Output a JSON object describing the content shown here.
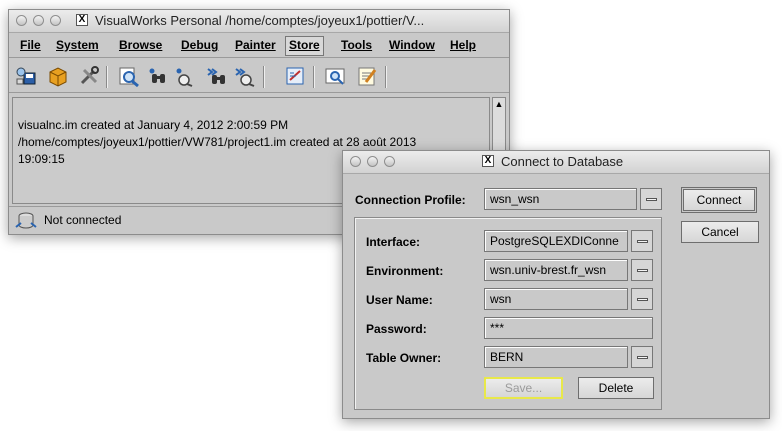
{
  "main_window": {
    "title": "VisualWorks Personal   /home/comptes/joyeux1/pottier/V...",
    "menu": [
      "File",
      "System",
      "Browse",
      "Debug",
      "Painter",
      "Store",
      "Tools",
      "Window",
      "Help"
    ],
    "toolbar_icons": [
      "save-image-icon",
      "parcel-icon",
      "tools-icon",
      "browser-icon",
      "find-class-icon",
      "find-method-icon",
      "implementors-icon",
      "senders-icon",
      "workspace-icon",
      "inspect-icon",
      "notepad-icon"
    ],
    "transcript_lines": [
      "visualnc.im created at January 4, 2012 2:00:59 PM",
      "/home/comptes/joyeux1/pottier/VW781/project1.im created at 28 août 2013",
      "19:09:15"
    ],
    "status": "Not connected"
  },
  "dialog": {
    "title": "Connect to Database",
    "connection_profile_label": "Connection Profile:",
    "connection_profile_value": "wsn_wsn",
    "connect_button": "Connect",
    "cancel_button": "Cancel",
    "fields": {
      "interface_label": "Interface:",
      "interface_value": "PostgreSQLEXDIConne",
      "environment_label": "Environment:",
      "environment_value": "wsn.univ-brest.fr_wsn",
      "user_label": "User Name:",
      "user_value": "wsn",
      "password_label": "Password:",
      "password_value": "***",
      "owner_label": "Table Owner:",
      "owner_value": "BERN"
    },
    "save_button": "Save...",
    "delete_button": "Delete"
  },
  "colors": {
    "window_bg": "#c9c9c9",
    "save_focus_border": "#e8e84a"
  }
}
